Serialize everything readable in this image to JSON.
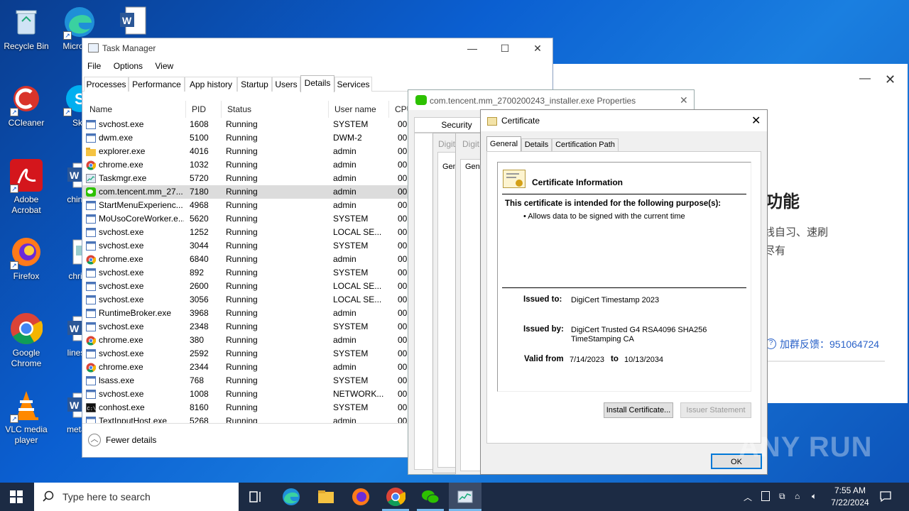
{
  "desktop": {
    "icons": [
      {
        "label": "Recycle Bin",
        "icon": "recycle-bin-icon"
      },
      {
        "label": "CCleaner",
        "icon": "ccleaner-icon"
      },
      {
        "label": "Adobe Acrobat",
        "icon": "acrobat-icon"
      },
      {
        "label": "Firefox",
        "icon": "firefox-icon"
      },
      {
        "label": "Google Chrome",
        "icon": "chrome-icon"
      },
      {
        "label": "VLC media player",
        "icon": "vlc-icon"
      },
      {
        "label": "Micro Ed",
        "icon": "edge-icon"
      },
      {
        "label": "Sky",
        "icon": "skype-icon"
      },
      {
        "label": "chinap",
        "icon": "word-icon"
      },
      {
        "label": "christi",
        "icon": "image-file-icon"
      },
      {
        "label": "lineste",
        "icon": "word-icon"
      },
      {
        "label": "metaln",
        "icon": "word-icon"
      },
      {
        "label": "",
        "icon": "word-icon"
      }
    ]
  },
  "wechat_window": {
    "title_suffix": "功能",
    "lines": [
      "线自习、速刷",
      "尽有"
    ],
    "feedback": "加群反馈：951064724",
    "minimize": "—",
    "close": "✕"
  },
  "taskmgr": {
    "title": "Task Manager",
    "menu": [
      "File",
      "Options",
      "View"
    ],
    "tabs": [
      "Processes",
      "Performance",
      "App history",
      "Startup",
      "Users",
      "Details",
      "Services"
    ],
    "active_tab": "Details",
    "columns": [
      "Name",
      "PID",
      "Status",
      "User name",
      "CPU"
    ],
    "rows": [
      {
        "name": "svchost.exe",
        "pid": "1608",
        "status": "Running",
        "user": "SYSTEM",
        "cpu": "00",
        "icon": "svc"
      },
      {
        "name": "dwm.exe",
        "pid": "5100",
        "status": "Running",
        "user": "DWM-2",
        "cpu": "00",
        "icon": "svc"
      },
      {
        "name": "explorer.exe",
        "pid": "4016",
        "status": "Running",
        "user": "admin",
        "cpu": "00",
        "icon": "folder"
      },
      {
        "name": "chrome.exe",
        "pid": "1032",
        "status": "Running",
        "user": "admin",
        "cpu": "00",
        "icon": "chrome"
      },
      {
        "name": "Taskmgr.exe",
        "pid": "5720",
        "status": "Running",
        "user": "admin",
        "cpu": "00",
        "icon": "taskmgr"
      },
      {
        "name": "com.tencent.mm_27...",
        "pid": "7180",
        "status": "Running",
        "user": "admin",
        "cpu": "00",
        "icon": "wechat",
        "selected": true
      },
      {
        "name": "StartMenuExperienc...",
        "pid": "4968",
        "status": "Running",
        "user": "admin",
        "cpu": "00",
        "icon": "svc"
      },
      {
        "name": "MoUsoCoreWorker.e...",
        "pid": "5620",
        "status": "Running",
        "user": "SYSTEM",
        "cpu": "00",
        "icon": "svc"
      },
      {
        "name": "svchost.exe",
        "pid": "1252",
        "status": "Running",
        "user": "LOCAL SE...",
        "cpu": "00",
        "icon": "svc"
      },
      {
        "name": "svchost.exe",
        "pid": "3044",
        "status": "Running",
        "user": "SYSTEM",
        "cpu": "00",
        "icon": "svc"
      },
      {
        "name": "chrome.exe",
        "pid": "6840",
        "status": "Running",
        "user": "admin",
        "cpu": "00",
        "icon": "chrome"
      },
      {
        "name": "svchost.exe",
        "pid": "892",
        "status": "Running",
        "user": "SYSTEM",
        "cpu": "00",
        "icon": "svc"
      },
      {
        "name": "svchost.exe",
        "pid": "2600",
        "status": "Running",
        "user": "LOCAL SE...",
        "cpu": "00",
        "icon": "svc"
      },
      {
        "name": "svchost.exe",
        "pid": "3056",
        "status": "Running",
        "user": "LOCAL SE...",
        "cpu": "00",
        "icon": "svc"
      },
      {
        "name": "RuntimeBroker.exe",
        "pid": "3968",
        "status": "Running",
        "user": "admin",
        "cpu": "00",
        "icon": "svc"
      },
      {
        "name": "svchost.exe",
        "pid": "2348",
        "status": "Running",
        "user": "SYSTEM",
        "cpu": "00",
        "icon": "svc"
      },
      {
        "name": "chrome.exe",
        "pid": "380",
        "status": "Running",
        "user": "admin",
        "cpu": "00",
        "icon": "chrome"
      },
      {
        "name": "svchost.exe",
        "pid": "2592",
        "status": "Running",
        "user": "SYSTEM",
        "cpu": "00",
        "icon": "svc"
      },
      {
        "name": "chrome.exe",
        "pid": "2344",
        "status": "Running",
        "user": "admin",
        "cpu": "00",
        "icon": "chrome"
      },
      {
        "name": "lsass.exe",
        "pid": "768",
        "status": "Running",
        "user": "SYSTEM",
        "cpu": "00",
        "icon": "svc"
      },
      {
        "name": "svchost.exe",
        "pid": "1008",
        "status": "Running",
        "user": "NETWORK...",
        "cpu": "00",
        "icon": "svc"
      },
      {
        "name": "conhost.exe",
        "pid": "8160",
        "status": "Running",
        "user": "SYSTEM",
        "cpu": "00",
        "icon": "console"
      },
      {
        "name": "TextInputHost.exe",
        "pid": "5268",
        "status": "Running",
        "user": "admin",
        "cpu": "00",
        "icon": "svc"
      }
    ],
    "fewer_details": "Fewer details"
  },
  "properties": {
    "title": "com.tencent.mm_2700200243_installer.exe Properties",
    "tab_security": "Security",
    "digi_label_1": "Digit",
    "digi_label_2": "Digit",
    "gen_1": "Gene",
    "gen_2": "Gene"
  },
  "certificate": {
    "title": "Certificate",
    "tabs": [
      "General",
      "Details",
      "Certification Path"
    ],
    "heading": "Certificate Information",
    "purpose_heading": "This certificate is intended for the following purpose(s):",
    "purpose_item": "• Allows data to be signed with the current time",
    "issued_to_label": "Issued to:",
    "issued_to": "DigiCert Timestamp 2023",
    "issued_by_label": "Issued by:",
    "issued_by": "DigiCert Trusted G4 RSA4096 SHA256 TimeStamping CA",
    "valid_from_label": "Valid from",
    "valid_from": "7/14/2023",
    "to_label": "to",
    "valid_to": "10/13/2034",
    "install_btn": "Install Certificate...",
    "issuer_btn": "Issuer Statement",
    "ok_btn": "OK"
  },
  "watermark": "ANY RUN",
  "taskbar": {
    "search_placeholder": "Type here to search",
    "time": "7:55 AM",
    "date": "7/22/2024"
  },
  "colors": {
    "desktop": "#0b5fd1",
    "taskbar": "#1c2b44",
    "selection": "#dcdcdc",
    "link": "#2a62c8"
  }
}
